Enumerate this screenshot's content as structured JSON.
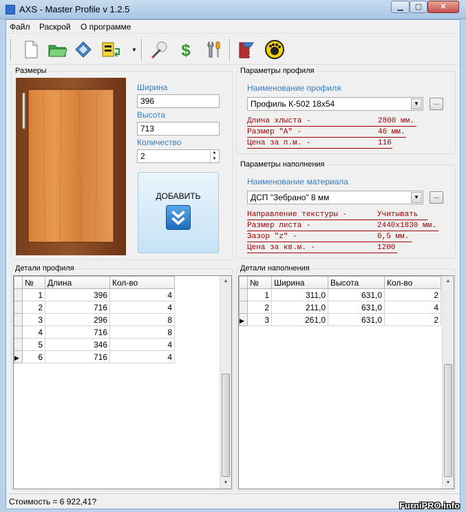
{
  "window": {
    "title": "AXS - Master Profile v 1.2.5"
  },
  "menu": [
    "Файл",
    "Раскрой",
    "О программе"
  ],
  "toolbar": [
    "new-document-icon",
    "open-folder-icon",
    "save-disk-icon",
    "export-icon",
    "cutting-tool-icon",
    "dollar-icon",
    "settings-tools-icon",
    "profile-icon",
    "help-icon"
  ],
  "sizes": {
    "group": "Размеры",
    "width_label": "Ширина",
    "width_value": "396",
    "height_label": "Высота",
    "height_value": "713",
    "qty_label": "Количество",
    "qty_value": "2",
    "add_button": "ДОБАВИТЬ"
  },
  "profile_params": {
    "group": "Параметры профиля",
    "name_label": "Наименование профиля",
    "selected": "Профиль К-502 18х54",
    "rows": [
      {
        "key": "Длина хлыста -",
        "value": "2800 мм."
      },
      {
        "key": "Размер \"А\" -",
        "value": "46 мм."
      },
      {
        "key": "Цена за п.м. -",
        "value": "116"
      }
    ]
  },
  "fill_params": {
    "group": "Параметры наполнения",
    "name_label": "Наименование материала",
    "selected": "ДСП \"Зебрано\" 8 мм",
    "rows": [
      {
        "key": "Направление текстуры -",
        "value": "Учитывать"
      },
      {
        "key": "Размер листа -",
        "value": "2440х1830 мм."
      },
      {
        "key": "Зазор \"z\" -",
        "value": "0,5 мм."
      },
      {
        "key": "Цена за кв.м. -",
        "value": "1200"
      }
    ]
  },
  "profile_details": {
    "group": "Детали профиля",
    "columns": [
      "№",
      "Длина",
      "Кол-во"
    ],
    "rows": [
      [
        "1",
        "396",
        "4"
      ],
      [
        "2",
        "716",
        "4"
      ],
      [
        "3",
        "296",
        "8"
      ],
      [
        "4",
        "716",
        "8"
      ],
      [
        "5",
        "346",
        "4"
      ],
      [
        "6",
        "716",
        "4"
      ]
    ],
    "current_row": 6
  },
  "fill_details": {
    "group": "Детали наполнения",
    "columns": [
      "№",
      "Ширина",
      "Высота",
      "Кол-во"
    ],
    "rows": [
      [
        "1",
        "311,0",
        "631,0",
        "2"
      ],
      [
        "2",
        "211,0",
        "631,0",
        "4"
      ],
      [
        "3",
        "261,0",
        "631,0",
        "2"
      ]
    ],
    "current_row": 3
  },
  "status": {
    "cost": "Стоимость = 6 922,41?"
  },
  "watermark": "FurniPRO.info",
  "colors": {
    "label_blue": "#3a7cc0",
    "param_red": "#a00000",
    "add_button": "#c6e2f5"
  }
}
